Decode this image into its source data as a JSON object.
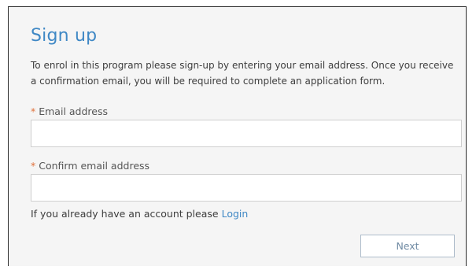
{
  "form": {
    "title": "Sign up",
    "intro": "To enrol in this program please sign-up by entering your email address. Once you receive a confirmation email, you will be required to complete an application form.",
    "required_marker": "*",
    "email_label": "Email address",
    "email_value": "",
    "confirm_label": "Confirm email address",
    "confirm_value": "",
    "account_prompt": "If you already have an account please",
    "login_link": "Login",
    "next_button": "Next"
  },
  "colors": {
    "title": "#3f88c5",
    "link": "#3f88c5",
    "required": "#e0703a",
    "panel_background": "#f5f5f5"
  }
}
